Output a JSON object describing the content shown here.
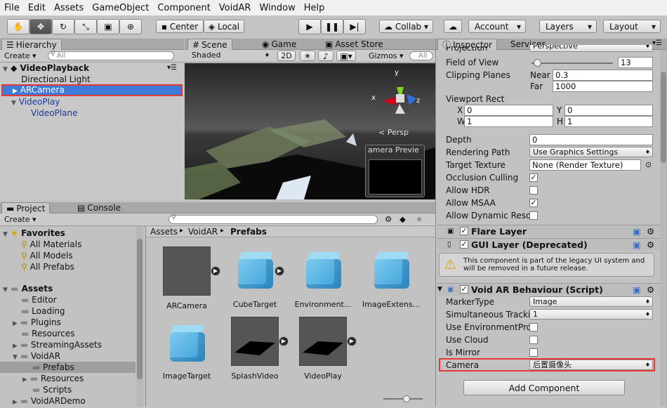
{
  "menu": [
    "File",
    "Edit",
    "Assets",
    "GameObject",
    "Component",
    "VoidAR",
    "Window",
    "Help"
  ],
  "toolbar": {
    "center": "Center",
    "local": "Local",
    "collab": "Collab ▾",
    "account": "Account",
    "layers": "Layers",
    "layout": "Layout"
  },
  "hierarchy": {
    "tab": "Hierarchy",
    "create": "Create ▾",
    "search": "All",
    "scene": "VideoPlayback",
    "items": [
      "Directional Light",
      "ARCamera",
      "VideoPlay",
      "VideoPlane"
    ]
  },
  "scene": {
    "tabs": [
      "Scene",
      "Game",
      "Asset Store"
    ],
    "shaded": "Shaded",
    "mode2d": "2D",
    "gizmos": "Gizmos ▾",
    "search": "All",
    "persp": "< Persp",
    "preview": "amera Previe",
    "axes": {
      "x": "x",
      "y": "y",
      "z": "z"
    }
  },
  "project": {
    "tabs": [
      "Project",
      "Console"
    ],
    "create": "Create ▾",
    "favorites": "Favorites",
    "fav_items": [
      "All Materials",
      "All Models",
      "All Prefabs"
    ],
    "assets": "Assets",
    "tree": [
      "Editor",
      "Loading",
      "Plugins",
      "Resources",
      "StreamingAssets",
      "VoidAR",
      "Prefabs",
      "Resources",
      "Scripts",
      "VoidARDemo"
    ],
    "breadcrumb": [
      "Assets",
      "VoidAR",
      "Prefabs"
    ],
    "grid": [
      "ARCamera",
      "CubeTarget",
      "Environment...",
      "ImageExtens...",
      "ImageTarget",
      "SplashVideo",
      "VideoPlay"
    ]
  },
  "inspector": {
    "tabs": [
      "Inspector",
      "Services"
    ],
    "projection_label": "Projection",
    "projection_value": "Perspective",
    "fov_label": "Field of View",
    "fov_value": "13",
    "clip_label": "Clipping Planes",
    "near_label": "Near",
    "near_value": "0.3",
    "far_label": "Far",
    "far_value": "1000",
    "viewport_label": "Viewport Rect",
    "x_label": "X",
    "x_value": "0",
    "y_label": "Y",
    "y_value": "0",
    "w_label": "W",
    "w_value": "1",
    "h_label": "H",
    "h_value": "1",
    "depth_label": "Depth",
    "depth_value": "0",
    "rpath_label": "Rendering Path",
    "rpath_value": "Use Graphics Settings",
    "target_label": "Target Texture",
    "target_value": "None (Render Texture)",
    "occlusion_label": "Occlusion Culling",
    "hdr_label": "Allow HDR",
    "msaa_label": "Allow MSAA",
    "dynres_label": "Allow Dynamic Reso",
    "flare": "Flare Layer",
    "gui": "GUI Layer (Deprecated)",
    "warning": "This component is part of the legacy UI system and will be removed in a future release.",
    "voidar": "Void AR Behaviour (Script)",
    "marker_label": "MarkerType",
    "marker_value": "Image",
    "simul_label": "Simultaneous Tracki",
    "simul_value": "1",
    "env_label": "Use EnvironmentPro",
    "cloud_label": "Use Cloud",
    "mirror_label": "Is Mirror",
    "camera_label": "Camera",
    "camera_value": "后置摄像头",
    "add_component": "Add Component"
  },
  "colors": {
    "accent": "#3d7bd9",
    "highlight_border": "#e53935",
    "panel": "#c2c2c2"
  }
}
